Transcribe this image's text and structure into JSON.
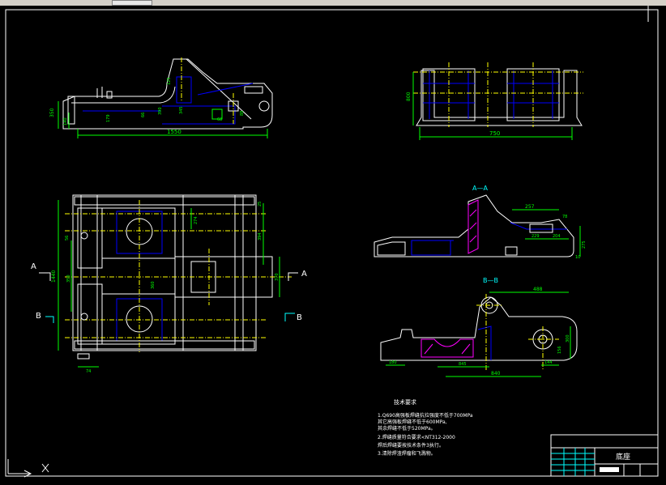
{
  "window": {
    "tab_label": ""
  },
  "colors": {
    "background": "#000000",
    "outline": "#ffffff",
    "dimension": "#00ff00",
    "hidden": "#0000ff",
    "center": "#ffff00",
    "section": "#00ffff",
    "hatch": "#ff00ff",
    "ucs": "#ffffff"
  },
  "views": {
    "top": {
      "dims": {
        "d_1550": "1550",
        "d_350": "350",
        "d_140": "140",
        "d_179": "179",
        "d_390": "390",
        "d_345": "345",
        "d_125": "125",
        "d_68": "68",
        "d_88": "88",
        "d_66": "66"
      }
    },
    "right": {
      "dims": {
        "d_750": "750",
        "d_800": "800"
      }
    },
    "plan": {
      "dims": {
        "d_1440": "1440",
        "d_350": "350",
        "d_56": "56",
        "d_274": "274",
        "d_394": "394",
        "d_360": "360",
        "d_370": "370",
        "d_74": "74",
        "d_25": "25"
      },
      "section_a_left": "A",
      "section_a_right": "A",
      "section_b_left": "B",
      "section_b_right": "B"
    },
    "section_aa": {
      "label": "A—A",
      "dims": {
        "d_257": "257",
        "d_204": "204",
        "d_78": "78",
        "d_229": "229",
        "d_275": "275",
        "d_10": "10"
      }
    },
    "section_bb": {
      "label": "B—B",
      "dims": {
        "d_488": "488",
        "d_840": "840",
        "d_845": "845",
        "d_180": "180",
        "d_144": "144",
        "d_300": "300",
        "d_156": "156"
      }
    }
  },
  "notes": {
    "title": "技术要求",
    "lines": [
      "1.Q690高强板焊缝抗拉强度不低于700MPa",
      "  其它高强板焊缝不低于600MPa,",
      "  其余焊缝不低于520MPa。",
      "2.焊缝质量符合要求<NT312-2000",
      "  焊后焊缝要按技术条件3执行。",
      "3.清除焊渣焊瘤和飞溅物。"
    ]
  },
  "title_block": {
    "drawing_name": "底座"
  }
}
